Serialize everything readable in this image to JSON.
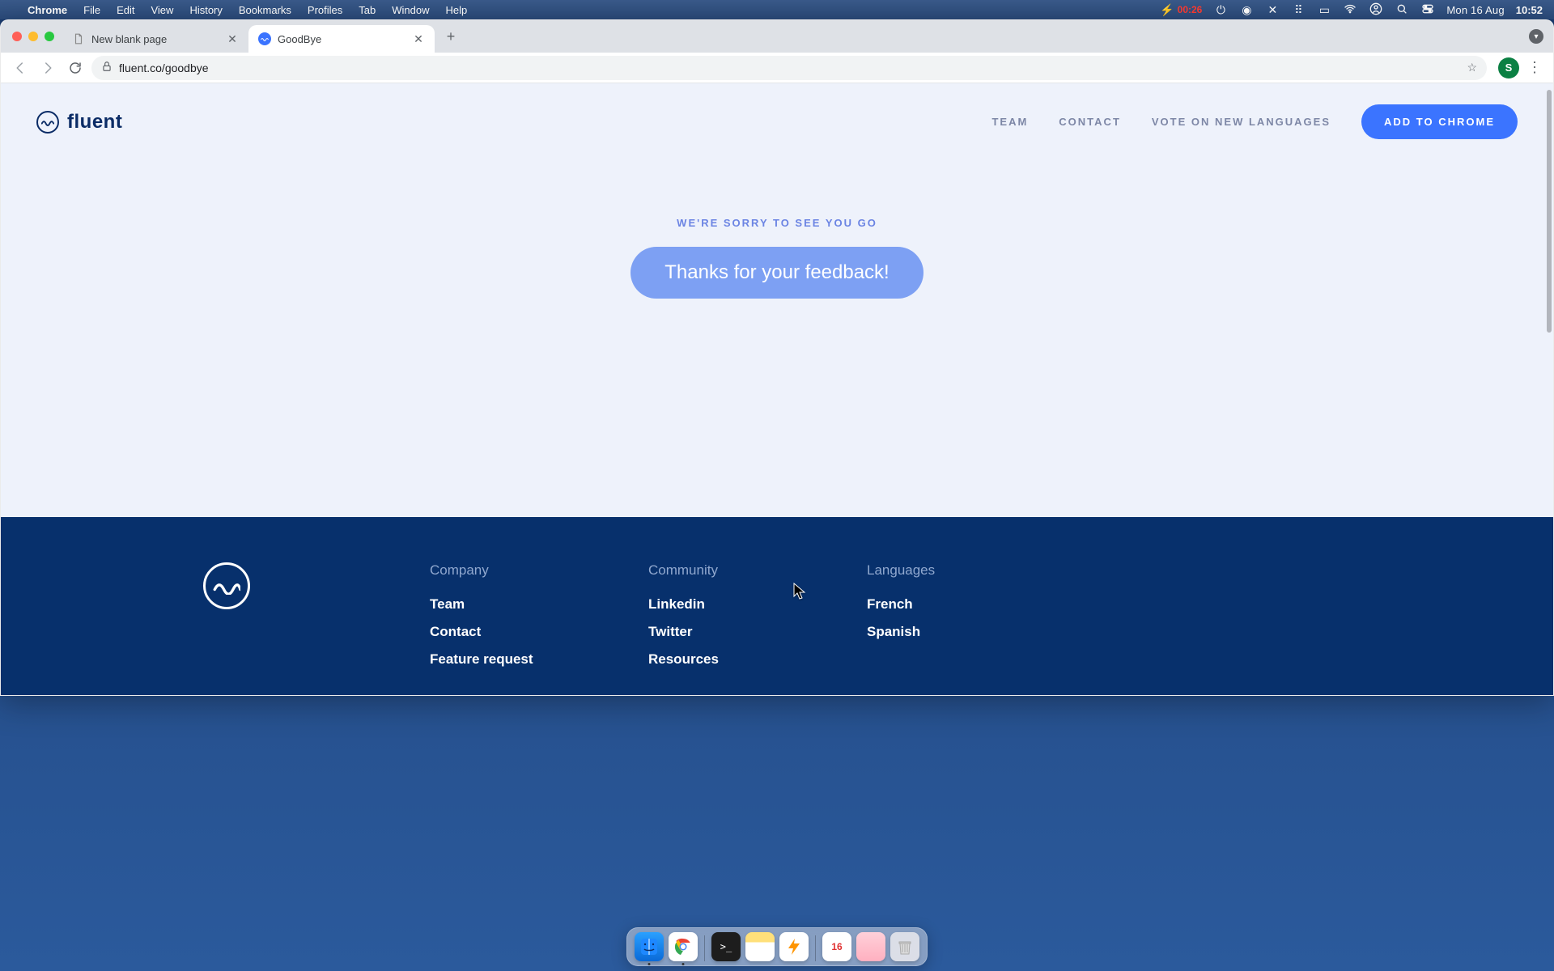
{
  "menubar": {
    "app": "Chrome",
    "items": [
      "File",
      "Edit",
      "View",
      "History",
      "Bookmarks",
      "Profiles",
      "Tab",
      "Window",
      "Help"
    ],
    "battery_time": "00:26",
    "date": "Mon 16 Aug",
    "clock": "10:52"
  },
  "tabs": {
    "t0": {
      "title": "New blank page"
    },
    "t1": {
      "title": "GoodBye"
    }
  },
  "toolbar": {
    "url": "fluent.co/goodbye",
    "avatar_initial": "S"
  },
  "page": {
    "brand": "fluent",
    "nav": {
      "team": "TEAM",
      "contact": "CONTACT",
      "vote": "VOTE ON NEW LANGUAGES",
      "cta": "ADD TO CHROME"
    },
    "eyebrow": "WE'RE SORRY TO SEE YOU GO",
    "thanks": "Thanks for your feedback!",
    "footer": {
      "company_h": "Company",
      "company": {
        "team": "Team",
        "contact": "Contact",
        "feature": "Feature request"
      },
      "community_h": "Community",
      "community": {
        "linkedin": "Linkedin",
        "twitter": "Twitter",
        "resources": "Resources"
      },
      "languages_h": "Languages",
      "languages": {
        "french": "French",
        "spanish": "Spanish"
      }
    }
  }
}
